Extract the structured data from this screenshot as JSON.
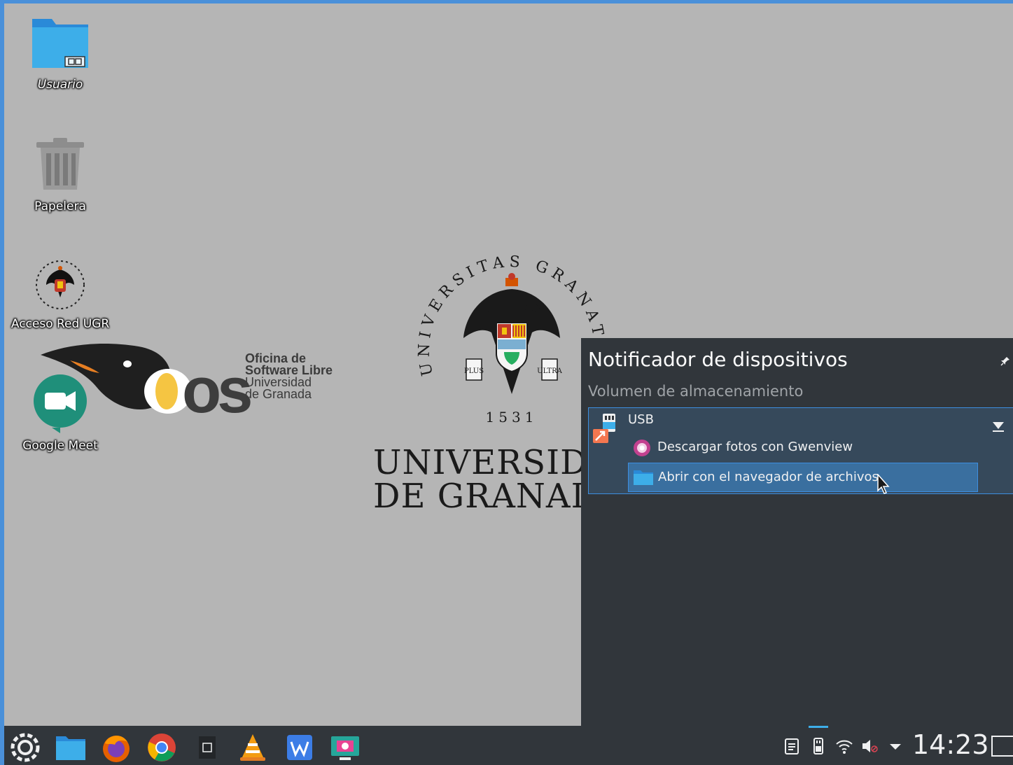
{
  "desktop": {
    "icons": [
      {
        "label": "Usuario",
        "icon": "folder-home-icon"
      },
      {
        "label": "Papelera",
        "icon": "trash-icon"
      },
      {
        "label": "Acceso Red UGR",
        "icon": "ugr-crest-icon"
      },
      {
        "label": "Google Meet",
        "icon": "google-meet-icon"
      }
    ],
    "osl_logo": {
      "mark": "osl",
      "lines": [
        "Oficina de",
        "Software Libre",
        "Universidad",
        "de Granada"
      ]
    },
    "ugr_logo": {
      "ring_text": "UNIVERSITAS GRANATENSIS",
      "year": "1531",
      "shield_left": "PLUS",
      "shield_right": "ULTRA",
      "name_line1": "UNIVERSIDAD",
      "name_line2": "DE GRANADA"
    }
  },
  "popup": {
    "title": "Notificador de dispositivos",
    "subtitle": "Volumen de almacenamiento",
    "device": {
      "name": "USB",
      "actions": [
        {
          "label": "Descargar fotos con Gwenview",
          "icon": "gwenview-icon"
        },
        {
          "label": "Abrir con el navegador de archivos",
          "icon": "folder-icon",
          "highlighted": true
        }
      ]
    }
  },
  "taskbar": {
    "launchers": [
      "application-launcher-icon",
      "file-manager-icon",
      "firefox-icon",
      "chrome-icon",
      "notes-icon",
      "vlc-icon",
      "wps-writer-icon",
      "screenshot-icon"
    ],
    "tray": [
      "clipboard-icon",
      "usb-device-icon",
      "wifi-icon",
      "volume-muted-icon",
      "tray-expand-icon"
    ],
    "clock": "14:23"
  },
  "colors": {
    "desktop_bg": "#b5b5b5",
    "panel_bg": "#31363b",
    "accent": "#3d8ee0"
  }
}
